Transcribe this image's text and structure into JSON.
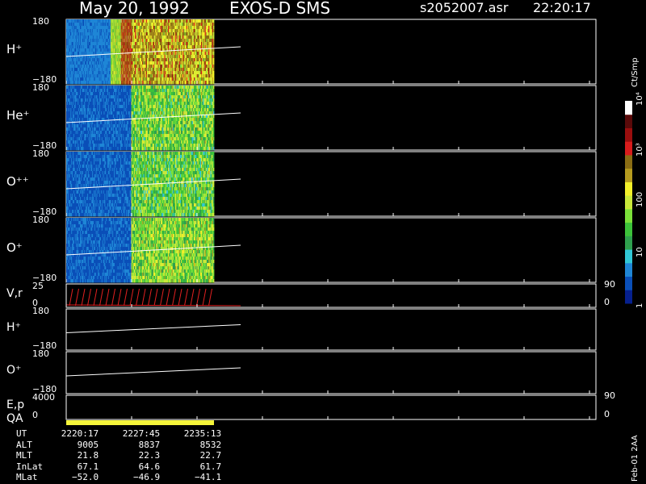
{
  "header": {
    "date": "May 20, 1992",
    "instrument": "EXOS-D SMS",
    "file": "s2052007.asr",
    "time": "22:20:17"
  },
  "colorbar": {
    "title": "Ct/Smp",
    "labels": [
      {
        "text": "1",
        "value": 1
      },
      {
        "text": "10",
        "value": 10
      },
      {
        "text": "100",
        "value": 100
      },
      {
        "text": "10³",
        "value": 1000
      },
      {
        "text": "10⁴",
        "value": 10000
      }
    ],
    "colors": [
      "#06208e",
      "#0a4fb8",
      "#1f86d6",
      "#31c7d6",
      "#2fa04e",
      "#3cc23a",
      "#7be03a",
      "#c9e83a",
      "#f2f02a",
      "#b59b1f",
      "#8a6d14",
      "#d81c1c",
      "#9a0e0e",
      "#5a0a0a",
      "#ffffff"
    ]
  },
  "chart_data": {
    "type": "heatmap",
    "title": "May 20, 1992   EXOS-D SMS",
    "colorbar_unit": "Ct/Smp",
    "color_scale": "log",
    "color_range": [
      1,
      10000
    ],
    "panels": [
      {
        "label": "H⁺",
        "ylim": [
          -180,
          180
        ],
        "ytick_labels": [
          "180",
          "−180"
        ],
        "data_segments": [
          {
            "t_start": 0.0,
            "t_end": 0.3,
            "level": 0.12
          },
          {
            "t_start": 0.3,
            "t_end": 0.37,
            "level": 0.45
          },
          {
            "t_start": 0.37,
            "t_end": 0.44,
            "level": 0.72
          },
          {
            "t_start": 0.44,
            "t_end": 1.0,
            "level": 0.6
          }
        ]
      },
      {
        "label": "He⁺",
        "ylim": [
          -180,
          180
        ],
        "ytick_labels": [
          "180",
          "−180"
        ],
        "data_segments": [
          {
            "t_start": 0.0,
            "t_end": 0.44,
            "level": 0.1
          },
          {
            "t_start": 0.44,
            "t_end": 1.0,
            "level": 0.38
          }
        ]
      },
      {
        "label": "O⁺⁺",
        "ylim": [
          -180,
          180
        ],
        "ytick_labels": [
          "180",
          "−180"
        ],
        "data_segments": [
          {
            "t_start": 0.0,
            "t_end": 0.44,
            "level": 0.1
          },
          {
            "t_start": 0.44,
            "t_end": 1.0,
            "level": 0.36
          }
        ]
      },
      {
        "label": "O⁺",
        "ylim": [
          -180,
          180
        ],
        "ytick_labels": [
          "180",
          "−180"
        ],
        "data_segments": [
          {
            "t_start": 0.0,
            "t_end": 0.44,
            "level": 0.1
          },
          {
            "t_start": 0.44,
            "t_end": 1.0,
            "level": 0.4
          }
        ]
      }
    ],
    "line_panels": [
      {
        "label": "V,r",
        "ylim": [
          0,
          25
        ],
        "ytick_labels": [
          "25",
          "0"
        ],
        "right_ticks": [
          "90",
          "0"
        ]
      },
      {
        "label": "H⁺",
        "ylim": [
          -180,
          180
        ],
        "ytick_labels": [
          "180",
          "−180"
        ]
      },
      {
        "label": "O⁺",
        "ylim": [
          -180,
          180
        ],
        "ytick_labels": [
          "180",
          "−180"
        ]
      },
      {
        "label": "E,p",
        "ylim": [
          0,
          4000
        ],
        "ytick_labels": [
          "4000",
          "0"
        ],
        "right_ticks": [
          "90",
          "0"
        ]
      }
    ],
    "qa_label": "QA",
    "ephemeris": {
      "rows": [
        {
          "name": "UT",
          "values": [
            "2220:17",
            "2227:45",
            "2235:13"
          ]
        },
        {
          "name": "ALT",
          "values": [
            "9005",
            "8837",
            "8532"
          ]
        },
        {
          "name": "MLT",
          "values": [
            "21.8",
            "22.3",
            "22.7"
          ]
        },
        {
          "name": "InLat",
          "values": [
            "67.1",
            "64.6",
            "61.7"
          ]
        },
        {
          "name": "MLat",
          "values": [
            "−52.0",
            "−46.9",
            "−41.1"
          ]
        }
      ]
    },
    "side_label": "Feb-01 2AA"
  }
}
